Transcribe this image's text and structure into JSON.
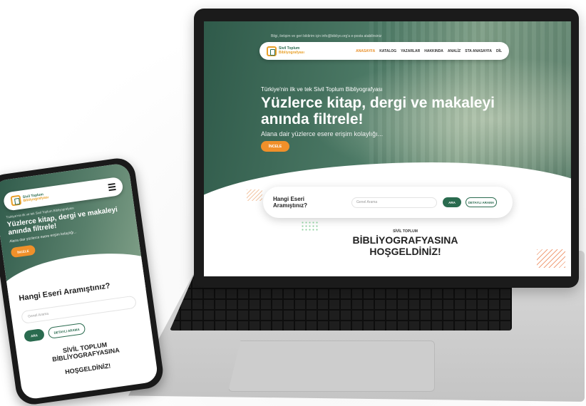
{
  "site": {
    "logo_line1": "Sivil Toplum",
    "logo_line2": "Bibliyografyası",
    "top_note": "Bilgi, iletişim ve geri bildirim için info@bibliyo.org'a e-posta atabilirsiniz"
  },
  "nav": {
    "items": [
      "ANASAYFA",
      "KATALOG",
      "YAZARLAR",
      "HAKKINDA",
      "ANALİZ",
      "STA ANASAYFA",
      "DİL"
    ]
  },
  "hero": {
    "kicker": "Türkiye'nin ilk ve tek Sivil Toplum Bibliyografyası",
    "title": "Yüzlerce kitap, dergi ve makaleyi anında filtrele!",
    "subtitle": "Alana dair yüzlerce esere erişim kolaylığı...",
    "button": "İNCELE"
  },
  "search": {
    "question": "Hangi Eseri Aramıştınız?",
    "placeholder": "Genel Arama",
    "search_button": "ARA",
    "detail_button": "DETAYLI ARAMA"
  },
  "welcome": {
    "small": "SİVİL TOPLUM",
    "line1": "BİBLİYOGRAFYASINA",
    "line2": "HOŞGELDİNİZ!"
  },
  "mobile": {
    "welcome_line1": "SİVİL TOPLUM",
    "welcome_line2": "BİBLİYOGRAFYASINA",
    "welcome_line3": "HOŞGELDİNİZ!"
  },
  "colors": {
    "brand_green": "#2a6b4f",
    "brand_orange": "#f0902a"
  }
}
